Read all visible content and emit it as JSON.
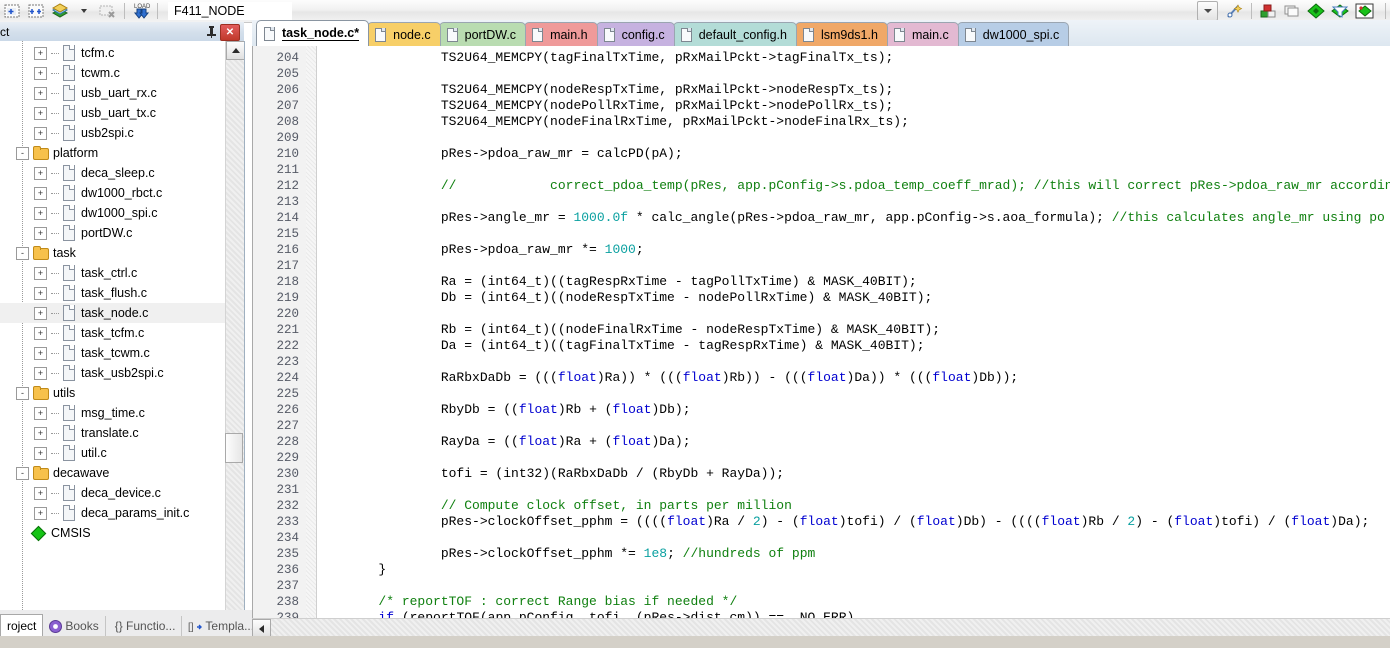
{
  "toolbar": {
    "icons": [
      "new-breakpoint-icon",
      "breakpoints-icon",
      "build-layers-icon",
      "dropdown-arrow-icon",
      "clear-breakpoints-icon",
      "load-download-icon"
    ],
    "project_combo_value": "F411_NODE",
    "combo_dropdown": "chevron-down-icon",
    "right_icons": [
      "magic-wand-icon",
      "build-target-icon",
      "copy-windows-icon",
      "green-diamond-icon",
      "filter-diamond-icon",
      "map-diamond-icon"
    ]
  },
  "left_panel": {
    "title": "ct",
    "pin_label": "⚖",
    "close_label": "✕",
    "tree": [
      {
        "label": "tcfm.c",
        "icon": "file-icon",
        "depth": 2,
        "expander": "+",
        "selected": false
      },
      {
        "label": "tcwm.c",
        "icon": "file-icon",
        "depth": 2,
        "expander": "+",
        "selected": false
      },
      {
        "label": "usb_uart_rx.c",
        "icon": "file-icon",
        "depth": 2,
        "expander": "+",
        "selected": false
      },
      {
        "label": "usb_uart_tx.c",
        "icon": "file-icon",
        "depth": 2,
        "expander": "+",
        "selected": false
      },
      {
        "label": "usb2spi.c",
        "icon": "file-icon",
        "depth": 2,
        "expander": "+",
        "selected": false
      },
      {
        "label": "platform",
        "icon": "folder-icon",
        "depth": 1,
        "expander": "-",
        "selected": false
      },
      {
        "label": "deca_sleep.c",
        "icon": "file-icon",
        "depth": 2,
        "expander": "+",
        "selected": false
      },
      {
        "label": "dw1000_rbct.c",
        "icon": "file-icon",
        "depth": 2,
        "expander": "+",
        "selected": false
      },
      {
        "label": "dw1000_spi.c",
        "icon": "file-icon",
        "depth": 2,
        "expander": "+",
        "selected": false
      },
      {
        "label": "portDW.c",
        "icon": "file-icon",
        "depth": 2,
        "expander": "+",
        "selected": false
      },
      {
        "label": "task",
        "icon": "folder-icon",
        "depth": 1,
        "expander": "-",
        "selected": false
      },
      {
        "label": "task_ctrl.c",
        "icon": "file-icon",
        "depth": 2,
        "expander": "+",
        "selected": false
      },
      {
        "label": "task_flush.c",
        "icon": "file-icon",
        "depth": 2,
        "expander": "+",
        "selected": false
      },
      {
        "label": "task_node.c",
        "icon": "file-icon",
        "depth": 2,
        "expander": "+",
        "selected": true
      },
      {
        "label": "task_tcfm.c",
        "icon": "file-icon",
        "depth": 2,
        "expander": "+",
        "selected": false
      },
      {
        "label": "task_tcwm.c",
        "icon": "file-icon",
        "depth": 2,
        "expander": "+",
        "selected": false
      },
      {
        "label": "task_usb2spi.c",
        "icon": "file-icon",
        "depth": 2,
        "expander": "+",
        "selected": false
      },
      {
        "label": "utils",
        "icon": "folder-icon",
        "depth": 1,
        "expander": "-",
        "selected": false
      },
      {
        "label": "msg_time.c",
        "icon": "file-icon",
        "depth": 2,
        "expander": "+",
        "selected": false
      },
      {
        "label": "translate.c",
        "icon": "file-icon",
        "depth": 2,
        "expander": "+",
        "selected": false
      },
      {
        "label": "util.c",
        "icon": "file-icon",
        "depth": 2,
        "expander": "+",
        "selected": false
      },
      {
        "label": "decawave",
        "icon": "folder-icon",
        "depth": 1,
        "expander": "-",
        "selected": false
      },
      {
        "label": "deca_device.c",
        "icon": "file-icon",
        "depth": 2,
        "expander": "+",
        "selected": false
      },
      {
        "label": "deca_params_init.c",
        "icon": "file-icon",
        "depth": 2,
        "expander": "+",
        "selected": false
      },
      {
        "label": "CMSIS",
        "icon": "green-diamond-icon",
        "depth": 1,
        "expander": "",
        "selected": false
      }
    ]
  },
  "bottom_tabs": [
    {
      "label": "roject",
      "icon": "",
      "active": true
    },
    {
      "label": "Books",
      "icon": "books-icon",
      "active": false
    },
    {
      "label": "{} Functio...",
      "icon": "functions-icon",
      "active": false
    },
    {
      "label": "Templa...",
      "icon": "templates-icon",
      "active": false
    }
  ],
  "editor_tabs": [
    {
      "label": "task_node.c*",
      "color": "#ffffff",
      "active": true
    },
    {
      "label": "node.c",
      "color": "#f7cf68",
      "active": false
    },
    {
      "label": "portDW.c",
      "color": "#b9dcb1",
      "active": false
    },
    {
      "label": "main.h",
      "color": "#ef9a9a",
      "active": false
    },
    {
      "label": "config.c",
      "color": "#c6b2e0",
      "active": false
    },
    {
      "label": "default_config.h",
      "color": "#b3dcd7",
      "active": false
    },
    {
      "label": "lsm9ds1.h",
      "color": "#f0a868",
      "active": false
    },
    {
      "label": "main.c",
      "color": "#e3b9d2",
      "active": false
    },
    {
      "label": "dw1000_spi.c",
      "color": "#b7cde6",
      "active": false
    }
  ],
  "editor": {
    "first_line": 204,
    "lines": [
      {
        "n": 204,
        "segs": [
          {
            "t": "                TS2U64_MEMCPY(tagFinalTxTime, pRxMailPckt->tagFinalTx_ts);",
            "c": ""
          }
        ]
      },
      {
        "n": 205,
        "segs": [
          {
            "t": "",
            "c": ""
          }
        ]
      },
      {
        "n": 206,
        "segs": [
          {
            "t": "                TS2U64_MEMCPY(nodeRespTxTime, pRxMailPckt->nodeRespTx_ts);",
            "c": ""
          }
        ]
      },
      {
        "n": 207,
        "segs": [
          {
            "t": "                TS2U64_MEMCPY(nodePollRxTime, pRxMailPckt->nodePollRx_ts);",
            "c": ""
          }
        ]
      },
      {
        "n": 208,
        "segs": [
          {
            "t": "                TS2U64_MEMCPY(nodeFinalRxTime, pRxMailPckt->nodeFinalRx_ts);",
            "c": ""
          }
        ]
      },
      {
        "n": 209,
        "segs": [
          {
            "t": "",
            "c": ""
          }
        ]
      },
      {
        "n": 210,
        "segs": [
          {
            "t": "                pRes->pdoa_raw_mr = calcPD(pA);",
            "c": ""
          }
        ]
      },
      {
        "n": 211,
        "segs": [
          {
            "t": "",
            "c": ""
          }
        ]
      },
      {
        "n": 212,
        "segs": [
          {
            "t": "                //            correct_pdoa_temp(pRes, app.pConfig->s.pdoa_temp_coeff_mrad); //this will correct pRes->pdoa_raw_mr accordin",
            "c": "cm"
          }
        ]
      },
      {
        "n": 213,
        "segs": [
          {
            "t": "",
            "c": ""
          }
        ]
      },
      {
        "n": 214,
        "segs": [
          {
            "t": "                pRes->angle_mr = ",
            "c": ""
          },
          {
            "t": "1000.0f",
            "c": "num"
          },
          {
            "t": " * calc_angle(pRes->pdoa_raw_mr, app.pConfig->s.aoa_formula); ",
            "c": ""
          },
          {
            "t": "//this calculates angle_mr using po",
            "c": "cm"
          }
        ]
      },
      {
        "n": 215,
        "segs": [
          {
            "t": "",
            "c": ""
          }
        ]
      },
      {
        "n": 216,
        "segs": [
          {
            "t": "                pRes->pdoa_raw_mr *= ",
            "c": ""
          },
          {
            "t": "1000",
            "c": "num"
          },
          {
            "t": ";",
            "c": ""
          }
        ]
      },
      {
        "n": 217,
        "segs": [
          {
            "t": "",
            "c": ""
          }
        ]
      },
      {
        "n": 218,
        "segs": [
          {
            "t": "                Ra = (int64_t)((tagRespRxTime - tagPollTxTime) & MASK_40BIT);",
            "c": ""
          }
        ]
      },
      {
        "n": 219,
        "segs": [
          {
            "t": "                Db = (int64_t)((nodeRespTxTime - nodePollRxTime) & MASK_40BIT);",
            "c": ""
          }
        ]
      },
      {
        "n": 220,
        "segs": [
          {
            "t": "",
            "c": ""
          }
        ]
      },
      {
        "n": 221,
        "segs": [
          {
            "t": "                Rb = (int64_t)((nodeFinalRxTime - nodeRespTxTime) & MASK_40BIT);",
            "c": ""
          }
        ]
      },
      {
        "n": 222,
        "segs": [
          {
            "t": "                Da = (int64_t)((tagFinalTxTime - tagRespRxTime) & MASK_40BIT);",
            "c": ""
          }
        ]
      },
      {
        "n": 223,
        "segs": [
          {
            "t": "",
            "c": ""
          }
        ]
      },
      {
        "n": 224,
        "segs": [
          {
            "t": "                RaRbxDaDb = (((",
            "c": ""
          },
          {
            "t": "float",
            "c": "kw"
          },
          {
            "t": ")Ra)) * (((",
            "c": ""
          },
          {
            "t": "float",
            "c": "kw"
          },
          {
            "t": ")Rb)) - (((",
            "c": ""
          },
          {
            "t": "float",
            "c": "kw"
          },
          {
            "t": ")Da)) * (((",
            "c": ""
          },
          {
            "t": "float",
            "c": "kw"
          },
          {
            "t": ")Db));",
            "c": ""
          }
        ]
      },
      {
        "n": 225,
        "segs": [
          {
            "t": "",
            "c": ""
          }
        ]
      },
      {
        "n": 226,
        "segs": [
          {
            "t": "                RbyDb = ((",
            "c": ""
          },
          {
            "t": "float",
            "c": "kw"
          },
          {
            "t": ")Rb + (",
            "c": ""
          },
          {
            "t": "float",
            "c": "kw"
          },
          {
            "t": ")Db);",
            "c": ""
          }
        ]
      },
      {
        "n": 227,
        "segs": [
          {
            "t": "",
            "c": ""
          }
        ]
      },
      {
        "n": 228,
        "segs": [
          {
            "t": "                RayDa = ((",
            "c": ""
          },
          {
            "t": "float",
            "c": "kw"
          },
          {
            "t": ")Ra + (",
            "c": ""
          },
          {
            "t": "float",
            "c": "kw"
          },
          {
            "t": ")Da);",
            "c": ""
          }
        ]
      },
      {
        "n": 229,
        "segs": [
          {
            "t": "",
            "c": ""
          }
        ]
      },
      {
        "n": 230,
        "segs": [
          {
            "t": "                tofi = (int32)(RaRbxDaDb / (RbyDb + RayDa));",
            "c": ""
          }
        ]
      },
      {
        "n": 231,
        "segs": [
          {
            "t": "",
            "c": ""
          }
        ]
      },
      {
        "n": 232,
        "segs": [
          {
            "t": "                // Compute clock offset, in parts per million",
            "c": "cm"
          }
        ]
      },
      {
        "n": 233,
        "segs": [
          {
            "t": "                pRes->clockOffset_pphm = ((((",
            "c": ""
          },
          {
            "t": "float",
            "c": "kw"
          },
          {
            "t": ")Ra / ",
            "c": ""
          },
          {
            "t": "2",
            "c": "num"
          },
          {
            "t": ") - (",
            "c": ""
          },
          {
            "t": "float",
            "c": "kw"
          },
          {
            "t": ")tofi) / (",
            "c": ""
          },
          {
            "t": "float",
            "c": "kw"
          },
          {
            "t": ")Db) - ((((",
            "c": ""
          },
          {
            "t": "float",
            "c": "kw"
          },
          {
            "t": ")Rb / ",
            "c": ""
          },
          {
            "t": "2",
            "c": "num"
          },
          {
            "t": ") - (",
            "c": ""
          },
          {
            "t": "float",
            "c": "kw"
          },
          {
            "t": ")tofi) / (",
            "c": ""
          },
          {
            "t": "float",
            "c": "kw"
          },
          {
            "t": ")Da);",
            "c": ""
          }
        ]
      },
      {
        "n": 234,
        "segs": [
          {
            "t": "",
            "c": ""
          }
        ]
      },
      {
        "n": 235,
        "segs": [
          {
            "t": "                pRes->clockOffset_pphm *= ",
            "c": ""
          },
          {
            "t": "1e8",
            "c": "num"
          },
          {
            "t": "; ",
            "c": ""
          },
          {
            "t": "//hundreds of ppm",
            "c": "cm"
          }
        ]
      },
      {
        "n": 236,
        "segs": [
          {
            "t": "        }",
            "c": ""
          }
        ]
      },
      {
        "n": 237,
        "segs": [
          {
            "t": "",
            "c": ""
          }
        ]
      },
      {
        "n": 238,
        "segs": [
          {
            "t": "        /* reportTOF : correct Range bias if needed */",
            "c": "cm"
          }
        ]
      },
      {
        "n": 239,
        "segs": [
          {
            "t": "        ",
            "c": ""
          },
          {
            "t": "if",
            "c": "kw"
          },
          {
            "t": " (reportTOF(app.pConfig, tofi, (pRes->dist_cm)) == _NO_ERR)",
            "c": ""
          }
        ]
      }
    ]
  }
}
